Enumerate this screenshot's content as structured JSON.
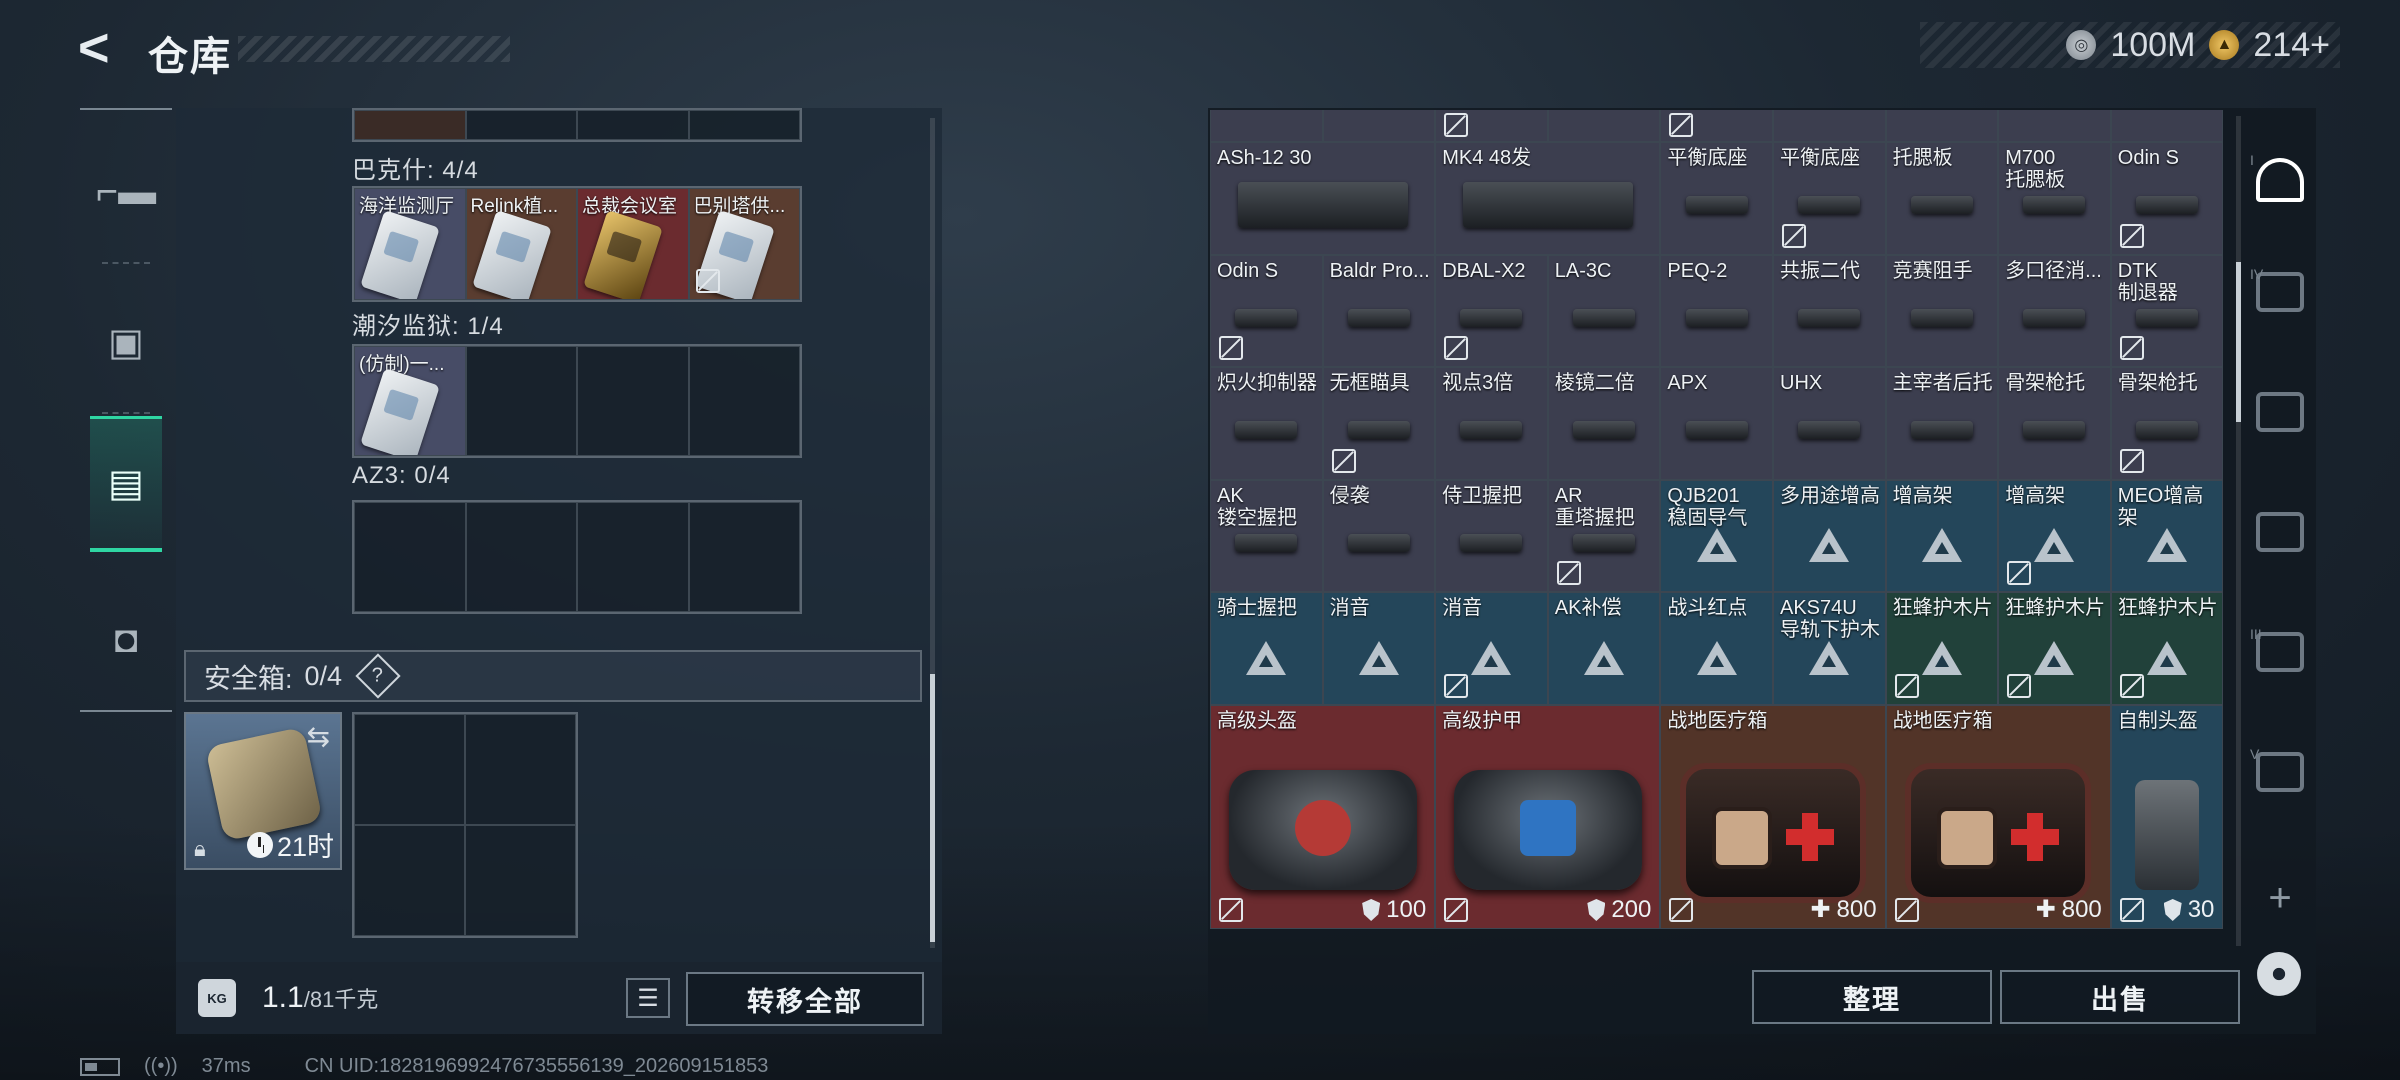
{
  "header": {
    "title": "仓库",
    "currency": [
      {
        "icon": "silver-coin-icon",
        "value": "100M"
      },
      {
        "icon": "gold-coin-icon",
        "value": "214+"
      }
    ]
  },
  "left": {
    "sections": [
      {
        "label": "巴克什: 4/4",
        "cards": [
          "海洋监测厅",
          "Relink植...",
          "总裁会议室",
          "巴别塔供..."
        ]
      },
      {
        "label": "潮汐监狱: 1/4",
        "cards": [
          "(仿制)一..."
        ]
      },
      {
        "label": "AZ3: 0/4",
        "cards": []
      }
    ],
    "safe": {
      "label": "安全箱:",
      "count": "0/4",
      "help": "?",
      "timer": "21时"
    },
    "footer": {
      "weight_value": "1.1",
      "weight_capacity": "/81千克",
      "kg_icon": "KG",
      "transfer_all": "转移全部"
    }
  },
  "right": {
    "rows": [
      [
        {
          "n": "ASh-12 30",
          "w": 2,
          "bg": "#3c3e4f"
        },
        {
          "n": "MK4 48发",
          "w": 2,
          "bg": "#3c3e4f"
        },
        {
          "n": "平衡底座",
          "w": 1,
          "bg": "#3c3e4f"
        },
        {
          "n": "平衡底座",
          "w": 1,
          "bg": "#3c3e4f",
          "nb": true
        },
        {
          "n": "托腮板",
          "w": 1,
          "bg": "#3c3e4f"
        },
        {
          "n": "M700\n托腮板",
          "w": 1,
          "bg": "#3c3e4f"
        },
        {
          "n": "Odin S",
          "w": 1,
          "bg": "#3c3e4f",
          "nb": true
        }
      ],
      [
        {
          "n": "Odin S",
          "w": 1,
          "bg": "#3c3e4f",
          "nb": true
        },
        {
          "n": "Baldr Pro...",
          "w": 1,
          "bg": "#3c3e4f"
        },
        {
          "n": "DBAL-X2",
          "w": 1,
          "bg": "#3c3e4f",
          "nb": true
        },
        {
          "n": "LA-3C",
          "w": 1,
          "bg": "#3c3e4f"
        },
        {
          "n": "PEQ-2",
          "w": 1,
          "bg": "#3c3e4f"
        },
        {
          "n": "共振二代",
          "w": 1,
          "bg": "#3c3e4f"
        },
        {
          "n": "竞赛阻手",
          "w": 1,
          "bg": "#3c3e4f"
        },
        {
          "n": "多口径消...",
          "w": 1,
          "bg": "#3c3e4f"
        },
        {
          "n": "DTK\n制退器",
          "w": 1,
          "bg": "#3c3e4f",
          "nb": true
        }
      ],
      [
        {
          "n": "炽火抑制器",
          "w": 1,
          "bg": "#3c3e4f"
        },
        {
          "n": "无框瞄具",
          "w": 1,
          "bg": "#3c3e4f",
          "nb": true
        },
        {
          "n": "视点3倍",
          "w": 1,
          "bg": "#3c3e4f"
        },
        {
          "n": "棱镜二倍",
          "w": 1,
          "bg": "#3c3e4f"
        },
        {
          "n": "APX",
          "w": 1,
          "bg": "#3c3e4f"
        },
        {
          "n": "UHX",
          "w": 1,
          "bg": "#3c3e4f"
        },
        {
          "n": "主宰者后托",
          "w": 1,
          "bg": "#3c3e4f"
        },
        {
          "n": "骨架枪托",
          "w": 1,
          "bg": "#3c3e4f"
        },
        {
          "n": "骨架枪托",
          "w": 1,
          "bg": "#3c3e4f",
          "nb": true
        }
      ],
      [
        {
          "n": "AK\n镂空握把",
          "w": 1,
          "bg": "#3c3e4f"
        },
        {
          "n": "侵袭",
          "w": 1,
          "bg": "#3c3e4f"
        },
        {
          "n": "侍卫握把",
          "w": 1,
          "bg": "#3c3e4f"
        },
        {
          "n": "AR\n重塔握把",
          "w": 1,
          "bg": "#3c3e4f",
          "nb": true
        },
        {
          "n": "QJB201\n稳固导气",
          "w": 1,
          "bg": "#24465a",
          "tri": true
        },
        {
          "n": "多用途增高",
          "w": 1,
          "bg": "#24465a",
          "tri": true
        },
        {
          "n": "增高架",
          "w": 1,
          "bg": "#24465a",
          "tri": true
        },
        {
          "n": "增高架",
          "w": 1,
          "bg": "#24465a",
          "tri": true,
          "nb": true
        },
        {
          "n": "MEO增高架",
          "w": 1,
          "bg": "#24465a",
          "tri": true
        }
      ],
      [
        {
          "n": "骑士握把",
          "w": 1,
          "bg": "#24465a",
          "tri": true
        },
        {
          "n": "消音",
          "w": 1,
          "bg": "#24465a",
          "tri": true
        },
        {
          "n": "消音",
          "w": 1,
          "bg": "#24465a",
          "tri": true,
          "nb": true
        },
        {
          "n": "AK补偿",
          "w": 1,
          "bg": "#24465a",
          "tri": true
        },
        {
          "n": "战斗红点",
          "w": 1,
          "bg": "#24465a",
          "tri": true
        },
        {
          "n": "AKS74U\n导轨下护木",
          "w": 1,
          "bg": "#24465a",
          "tri": true
        },
        {
          "n": "狂蜂护木片",
          "w": 1,
          "bg": "#21413a",
          "tri": true,
          "nb": true
        },
        {
          "n": "狂蜂护木片",
          "w": 1,
          "bg": "#21413a",
          "tri": true,
          "nb": true
        },
        {
          "n": "狂蜂护木片",
          "w": 1,
          "bg": "#21413a",
          "tri": true,
          "nb": true
        }
      ]
    ],
    "big": [
      {
        "n": "高级头盔",
        "bg": "#6b2b2f",
        "kind": "bag",
        "stat_icon": "shield",
        "stat": "100"
      },
      {
        "n": "高级护甲",
        "bg": "#6b2b2f",
        "kind": "bag-blue",
        "stat_icon": "shield",
        "stat": "200"
      },
      {
        "n": "战地医疗箱",
        "bg": "#523428",
        "kind": "medkit",
        "stat_icon": "plus",
        "stat": "800"
      },
      {
        "n": "战地医疗箱",
        "bg": "#523428",
        "kind": "medkit",
        "stat_icon": "plus",
        "stat": "800"
      },
      {
        "n": "自制头盔",
        "bg": "#24465a",
        "kind": "helmet",
        "stat_icon": "shield",
        "stat": "30"
      }
    ],
    "buttons": {
      "sort": "整理",
      "sell": "出售"
    },
    "side_tabs": [
      "I",
      "IV",
      "",
      "",
      "III",
      "V"
    ]
  },
  "status": {
    "ping": "37ms",
    "uid": "CN UID:1828196992476735556139_202609151853"
  },
  "colors": {
    "accent": "#2fd6a3",
    "rare_blue": "#24465a",
    "epic_red": "#6b2b2f"
  }
}
